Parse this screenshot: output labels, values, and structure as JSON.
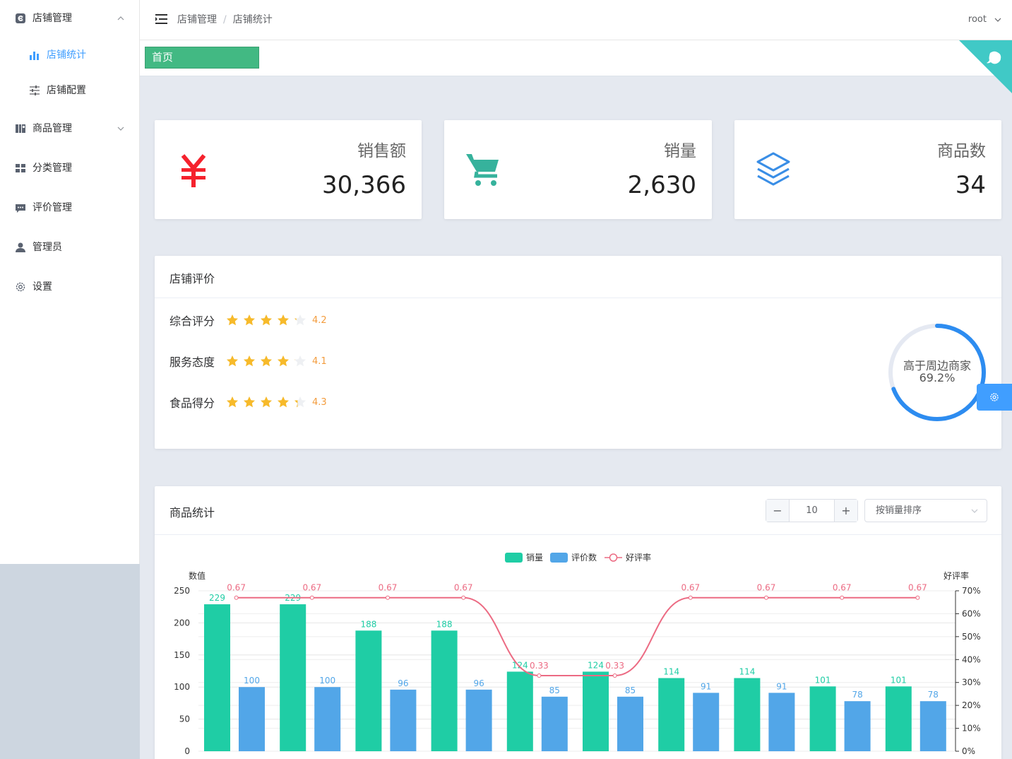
{
  "sidebar": {
    "groups": [
      {
        "label": "店铺管理",
        "icon": "store-icon",
        "expanded": true
      },
      {
        "label": "商品管理",
        "icon": "goods-icon",
        "expanded": false
      },
      {
        "label": "分类管理",
        "icon": "grid-icon"
      },
      {
        "label": "评价管理",
        "icon": "comment-icon"
      },
      {
        "label": "管理员",
        "icon": "user-icon"
      },
      {
        "label": "设置",
        "icon": "gear-icon"
      }
    ],
    "sub_items": [
      {
        "label": "店铺统计",
        "icon": "bar-chart-icon",
        "active": true
      },
      {
        "label": "店铺配置",
        "icon": "sliders-icon",
        "active": false
      }
    ]
  },
  "header": {
    "breadcrumb": [
      "店铺管理",
      "店铺统计"
    ],
    "user": "root"
  },
  "tags": {
    "home": "首页"
  },
  "stats": [
    {
      "title": "销售额",
      "value": "30,366",
      "icon": "yuan-icon",
      "color": "#f5222d"
    },
    {
      "title": "销量",
      "value": "2,630",
      "icon": "cart-icon",
      "color": "#36b29c"
    },
    {
      "title": "商品数",
      "value": "34",
      "icon": "layers-icon",
      "color": "#3a8ee6"
    }
  ],
  "review": {
    "title": "店铺评价",
    "rows": [
      {
        "label": "综合评分",
        "score": "4.2",
        "value": 4.2
      },
      {
        "label": "服务态度",
        "score": "4.1",
        "value": 4.1
      },
      {
        "label": "食品得分",
        "score": "4.3",
        "value": 4.3
      }
    ],
    "gauge": {
      "label": "高于周边商家",
      "value_text": "69.2%",
      "value": 0.692
    }
  },
  "products": {
    "title": "商品统计",
    "count": "10",
    "minus": "−",
    "plus": "+",
    "sort": "按销量排序"
  },
  "chart_data": {
    "type": "bar",
    "legend": [
      "销量",
      "评价数",
      "好评率"
    ],
    "ylabel": "数值",
    "ylabel_right": "好评率",
    "ylim": [
      0,
      250
    ],
    "ylim_right": [
      0,
      0.7
    ],
    "yticks": [
      0,
      50,
      100,
      150,
      200,
      250
    ],
    "yticks_right": [
      "0%",
      "10%",
      "20%",
      "30%",
      "40%",
      "50%",
      "60%",
      "70%"
    ],
    "series": [
      {
        "name": "销量",
        "color": "#1fcda5",
        "values": [
          229,
          229,
          188,
          188,
          124,
          124,
          114,
          114,
          101,
          101
        ]
      },
      {
        "name": "评价数",
        "color": "#52a6e8",
        "values": [
          100,
          100,
          96,
          96,
          85,
          85,
          91,
          91,
          78,
          78
        ]
      },
      {
        "name": "好评率",
        "color": "#ec6b83",
        "values": [
          0.67,
          0.67,
          0.67,
          0.67,
          0.33,
          0.33,
          0.67,
          0.67,
          0.67,
          0.67
        ]
      }
    ]
  }
}
